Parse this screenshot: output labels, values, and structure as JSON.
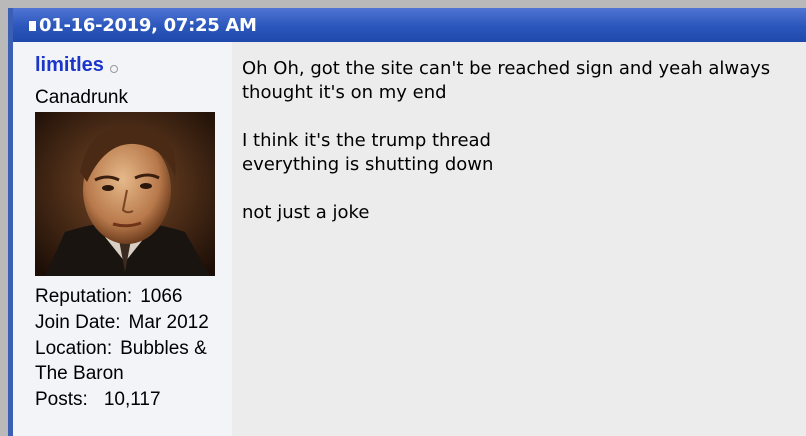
{
  "post": {
    "date": "01-16-2019, 07:25 AM",
    "user": {
      "name": "limitles",
      "title": "Canadrunk",
      "reputation_label": "Reputation:",
      "reputation": "1066",
      "join_label": "Join Date:",
      "join_date": "Mar 2012",
      "location_label": "Location:",
      "location": "Bubbles & The Baron",
      "posts_label": "Posts:",
      "posts": "10,117"
    },
    "message": [
      "Oh Oh, got the site can't be reached sign and yeah always thought it's on my end",
      "I think it's the trump thread\neverything is shutting down",
      "not just a joke"
    ]
  },
  "colors": {
    "header": "#2b56bb",
    "username": "#1c35c9",
    "message_bg": "#ececec",
    "user_bg": "#f2f4f8"
  },
  "icons": [
    "post-icon",
    "offline-status-icon"
  ]
}
